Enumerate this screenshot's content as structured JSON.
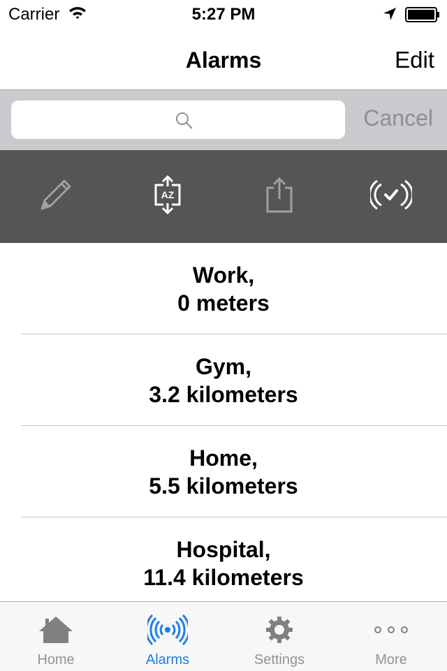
{
  "status_bar": {
    "carrier": "Carrier",
    "time": "5:27 PM",
    "icons": [
      "wifi-icon",
      "location-arrow-icon",
      "battery-icon"
    ]
  },
  "nav_bar": {
    "title": "Alarms",
    "edit_label": "Edit"
  },
  "search": {
    "placeholder": "",
    "value": "",
    "cancel_label": "Cancel"
  },
  "toolbar": {
    "tools": [
      {
        "icon": "pencil-icon",
        "state": "disabled"
      },
      {
        "icon": "sort-az-icon",
        "state": "enabled"
      },
      {
        "icon": "share-icon",
        "state": "disabled"
      },
      {
        "icon": "alarm-check-icon",
        "state": "enabled"
      }
    ]
  },
  "alarms": [
    {
      "name": "Work,",
      "distance": "0 meters"
    },
    {
      "name": "Gym,",
      "distance": "3.2 kilometers"
    },
    {
      "name": "Home,",
      "distance": "5.5 kilometers"
    },
    {
      "name": "Hospital,",
      "distance": "11.4 kilometers"
    }
  ],
  "tab_bar": {
    "active_color": "#1a7fe6",
    "inactive_color": "#929292",
    "tabs": [
      {
        "label": "Home",
        "icon": "home-icon",
        "active": false
      },
      {
        "label": "Alarms",
        "icon": "radio-waves-icon",
        "active": true
      },
      {
        "label": "Settings",
        "icon": "gear-icon",
        "active": false
      },
      {
        "label": "More",
        "icon": "more-dots-icon",
        "active": false
      }
    ]
  }
}
